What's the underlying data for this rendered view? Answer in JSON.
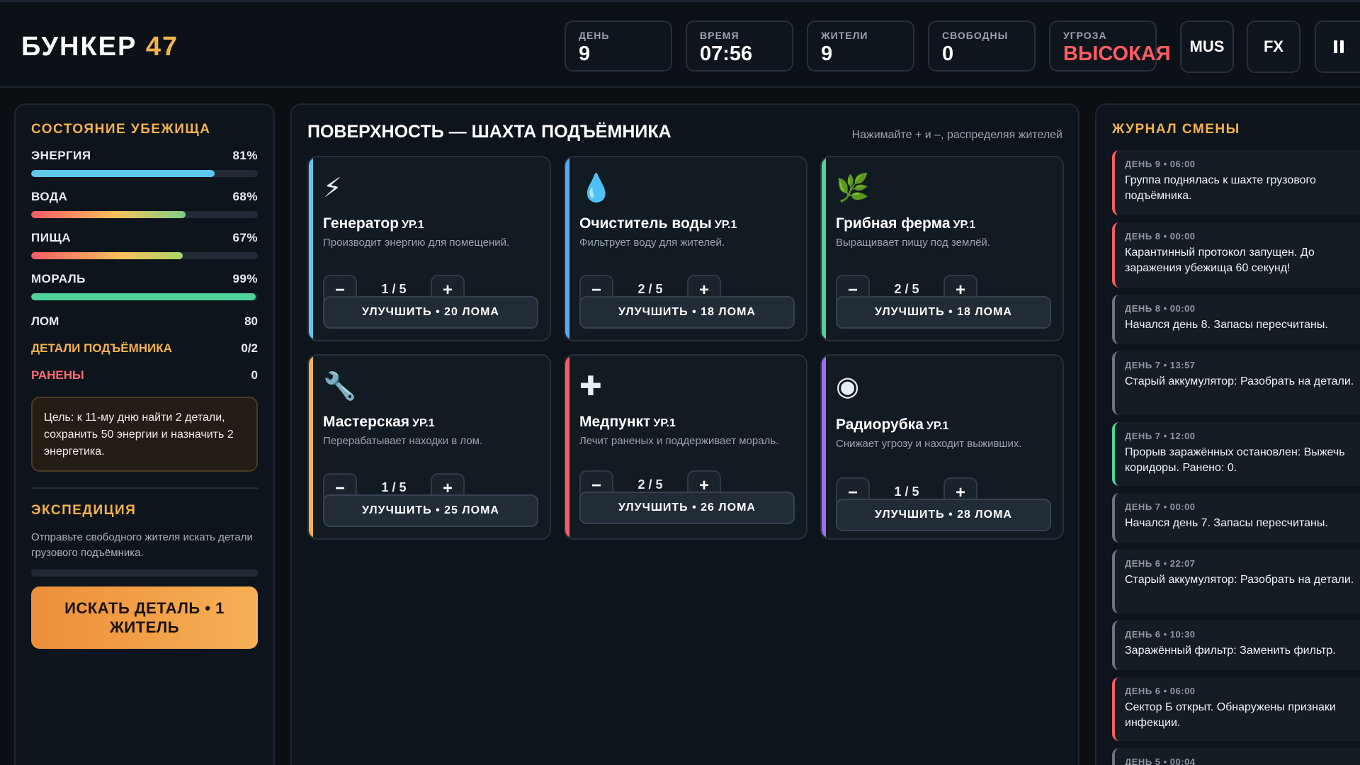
{
  "header": {
    "title_main": "БУНКЕР",
    "title_num": "47",
    "stats": [
      {
        "label": "ДЕНЬ",
        "value": "9"
      },
      {
        "label": "ВРЕМЯ",
        "value": "07:56"
      },
      {
        "label": "ЖИТЕЛИ",
        "value": "9"
      },
      {
        "label": "СВОБОДНЫ",
        "value": "0"
      },
      {
        "label": "УГРОЗА",
        "value": "ВЫСОКАЯ"
      }
    ],
    "mus_label": "MUS",
    "fx_label": "FX",
    "threat_color": "#ff5b62"
  },
  "left": {
    "state_title": "СОСТОЯНИЕ УБЕЖИЩА",
    "resources": [
      {
        "label": "ЭНЕРГИЯ",
        "display": "81%",
        "value": 81
      },
      {
        "label": "ВОДА",
        "display": "68%",
        "value": 68
      },
      {
        "label": "ПИЩА",
        "display": "67%",
        "value": 67
      },
      {
        "label": "МОРАЛЬ",
        "display": "99%",
        "value": 99
      }
    ],
    "scrap": {
      "label": "ЛОМ",
      "value": "80"
    },
    "parts": {
      "label": "ДЕТАЛИ ПОДЪЁМНИКА",
      "value": "0/2"
    },
    "wounded": {
      "label": "РАНЕНЫ",
      "value": "0"
    },
    "goal": "Цель: к 11-му дню найти 2 детали, сохранить 50 энергии и назначить 2 энергетика.",
    "expedition": {
      "title": "ЭКСПЕДИЦИЯ",
      "desc": "Отправьте свободного жителя искать детали грузового подъёмника.",
      "progress": 0,
      "button": "ИСКАТЬ ДЕТАЛЬ • 1 ЖИТЕЛЬ"
    }
  },
  "center": {
    "title": "ПОВЕРХНОСТЬ — ШАХТА ПОДЪЁМНИКА",
    "hint": "Нажимайте + и –, распределяя жителей",
    "rooms": [
      {
        "icon": "⚡",
        "icon_name": "lightning-icon",
        "name": "Генератор",
        "level": "УР.1",
        "desc": "Производит энергию для помещений.",
        "count": "1 / 5",
        "upgrade": "УЛУЧШИТЬ • 20 ЛОМА",
        "accent": "#5ec8ec"
      },
      {
        "icon": "💧",
        "icon_name": "water-drop-icon",
        "name": "Очиститель воды",
        "level": "УР.1",
        "desc": "Фильтрует воду для жителей.",
        "count": "2 / 5",
        "upgrade": "УЛУЧШИТЬ • 18 ЛОМА",
        "accent": "#5aa8f0"
      },
      {
        "icon": "🌿",
        "icon_name": "herb-icon",
        "name": "Грибная ферма",
        "level": "УР.1",
        "desc": "Выращивает пищу под землёй.",
        "count": "2 / 5",
        "upgrade": "УЛУЧШИТЬ • 18 ЛОМА",
        "accent": "#4fd39a"
      },
      {
        "icon": "🔧",
        "icon_name": "wrench-icon",
        "name": "Мастерская",
        "level": "УР.1",
        "desc": "Перерабатывает находки в лом.",
        "count": "1 / 5",
        "upgrade": "УЛУЧШИТЬ • 25 ЛОМА",
        "accent": "#f4b24e"
      },
      {
        "icon": "✚",
        "icon_name": "medical-cross-icon",
        "name": "Медпункт",
        "level": "УР.1",
        "desc": "Лечит раненых и поддерживает мораль.",
        "count": "2 / 5",
        "upgrade": "УЛУЧШИТЬ • 26 ЛОМА",
        "accent": "#ff5b62"
      },
      {
        "icon": "◉",
        "icon_name": "radio-icon",
        "name": "Радиорубка",
        "level": "УР.1",
        "desc": "Снижает угрозу и находит выживших.",
        "count": "1 / 5",
        "upgrade": "УЛУЧШИТЬ • 28 ЛОМА",
        "accent": "#a26cf0"
      }
    ],
    "minus": "−",
    "plus": "+"
  },
  "right": {
    "title": "ЖУРНАЛ СМЕНЫ",
    "logs": [
      {
        "time": "ДЕНЬ 9 • 06:00",
        "text": "Группа поднялась к шахте грузового подъёмника.",
        "tone": "red"
      },
      {
        "time": "ДЕНЬ 8 • 00:00",
        "text": "Карантинный протокол запущен. До заражения убежища 60 секунд!",
        "tone": "red"
      },
      {
        "time": "ДЕНЬ 8 • 00:00",
        "text": "Начался день 8. Запасы пересчитаны.",
        "tone": "gray"
      },
      {
        "time": "ДЕНЬ 7 • 13:57",
        "text": "Старый аккумулятор: Разобрать на детали.",
        "tone": "gray"
      },
      {
        "time": "ДЕНЬ 7 • 12:00",
        "text": "Прорыв заражённых остановлен: Выжечь коридоры. Ранено: 0.",
        "tone": "green"
      },
      {
        "time": "ДЕНЬ 7 • 00:00",
        "text": "Начался день 7. Запасы пересчитаны.",
        "tone": "gray"
      },
      {
        "time": "ДЕНЬ 6 • 22:07",
        "text": "Старый аккумулятор: Разобрать на детали.",
        "tone": "gray"
      },
      {
        "time": "ДЕНЬ 6 • 10:30",
        "text": "Заражённый фильтр: Заменить фильтр.",
        "tone": "gray"
      },
      {
        "time": "ДЕНЬ 6 • 06:00",
        "text": "Сектор Б открыт. Обнаружены признаки инфекции.",
        "tone": "red"
      },
      {
        "time": "ДЕНЬ 5 • 00:04",
        "text": "",
        "tone": "gray"
      }
    ]
  }
}
